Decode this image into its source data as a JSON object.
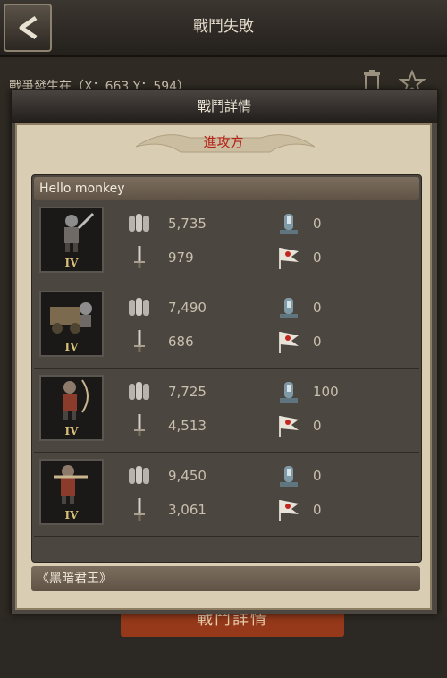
{
  "screen": {
    "title": "戰鬥失敗",
    "location_text": "戰爭發生在（X：663 Y：594）",
    "bottom_button_label": "戰鬥詳情"
  },
  "modal": {
    "title": "戰鬥詳情",
    "side_label": "進攻方",
    "player_name": "Hello monkey",
    "next_player_name": "《黑暗君王》",
    "units": [
      {
        "tier": "IV",
        "troops": "5,735",
        "losses": "0",
        "attack": "979",
        "kills": "0"
      },
      {
        "tier": "IV",
        "troops": "7,490",
        "losses": "0",
        "attack": "686",
        "kills": "0"
      },
      {
        "tier": "IV",
        "troops": "7,725",
        "losses": "100",
        "attack": "4,513",
        "kills": "0"
      },
      {
        "tier": "IV",
        "troops": "9,450",
        "losses": "0",
        "attack": "3,061",
        "kills": "0"
      }
    ]
  },
  "icons": {
    "back": "back-arrow-icon",
    "trash": "trash-icon",
    "star": "star-icon",
    "troops": "soldiers-icon",
    "losses": "tombstone-icon",
    "attack": "sword-icon",
    "kills": "flag-icon"
  },
  "colors": {
    "side_label": "#b5241b",
    "panel_bg": "#4b463f",
    "modal_body": "#d9cdb3",
    "button": "#9b3a1a"
  }
}
